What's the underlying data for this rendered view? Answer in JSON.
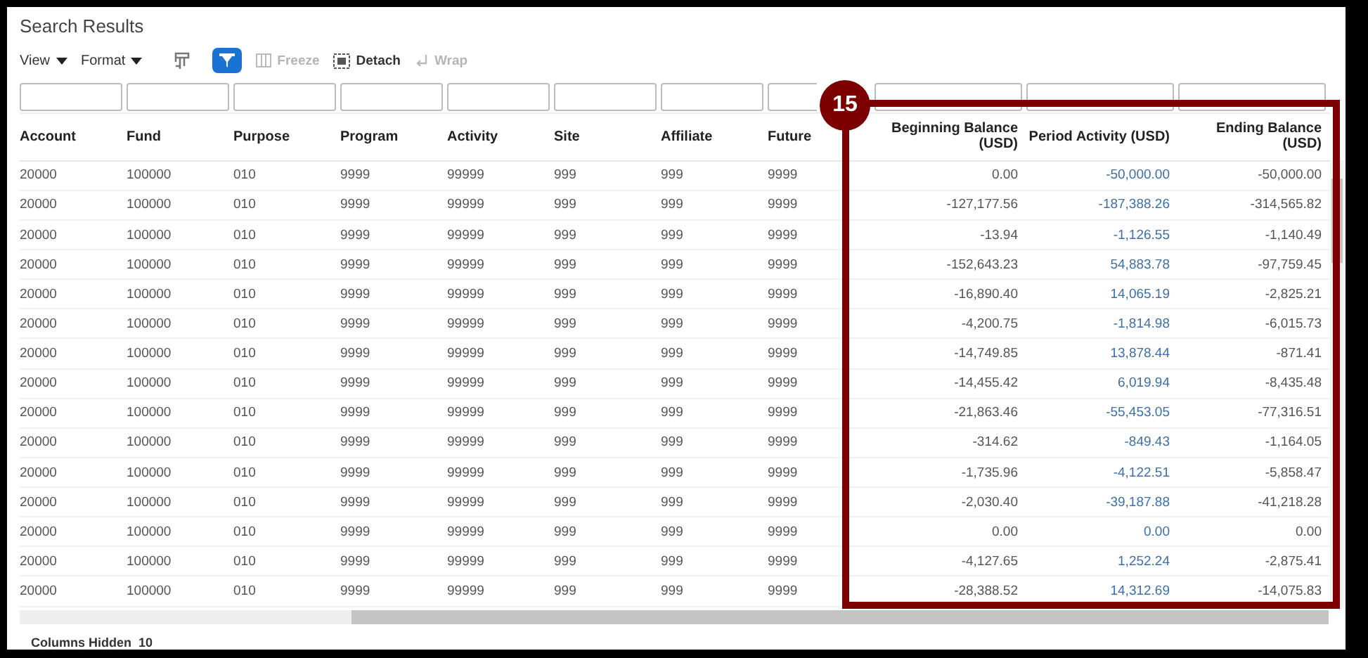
{
  "title": "Search Results",
  "toolbar": {
    "view_menu": {
      "label": "View"
    },
    "format_menu": {
      "label": "Format"
    },
    "query_button": {
      "disabled": false
    },
    "filter_toggle": {
      "selected": true
    },
    "buttons": [
      {
        "kind": "freeze",
        "label": "Freeze",
        "disabled": true
      },
      {
        "kind": "detach",
        "label": "Detach",
        "disabled": false
      },
      {
        "kind": "wrap",
        "label": "Wrap",
        "disabled": true
      }
    ]
  },
  "columns": [
    {
      "label": "Account",
      "kind": "text"
    },
    {
      "label": "Fund",
      "kind": "text"
    },
    {
      "label": "Purpose",
      "kind": "text"
    },
    {
      "label": "Program",
      "kind": "text"
    },
    {
      "label": "Activity",
      "kind": "text"
    },
    {
      "label": "Site",
      "kind": "text"
    },
    {
      "label": "Affiliate",
      "kind": "text"
    },
    {
      "label": "Future",
      "kind": "text"
    },
    {
      "label": "Beginning Balance (USD)",
      "kind": "amount"
    },
    {
      "label": "Period Activity (USD)",
      "kind": "link"
    },
    {
      "label": "Ending Balance (USD)",
      "kind": "amount"
    }
  ],
  "rows": [
    [
      "20000",
      "100000",
      "010",
      "9999",
      "99999",
      "999",
      "999",
      "9999",
      "0.00",
      "-50,000.00",
      "-50,000.00"
    ],
    [
      "20000",
      "100000",
      "010",
      "9999",
      "99999",
      "999",
      "999",
      "9999",
      "-127,177.56",
      "-187,388.26",
      "-314,565.82"
    ],
    [
      "20000",
      "100000",
      "010",
      "9999",
      "99999",
      "999",
      "999",
      "9999",
      "-13.94",
      "-1,126.55",
      "-1,140.49"
    ],
    [
      "20000",
      "100000",
      "010",
      "9999",
      "99999",
      "999",
      "999",
      "9999",
      "-152,643.23",
      "54,883.78",
      "-97,759.45"
    ],
    [
      "20000",
      "100000",
      "010",
      "9999",
      "99999",
      "999",
      "999",
      "9999",
      "-16,890.40",
      "14,065.19",
      "-2,825.21"
    ],
    [
      "20000",
      "100000",
      "010",
      "9999",
      "99999",
      "999",
      "999",
      "9999",
      "-4,200.75",
      "-1,814.98",
      "-6,015.73"
    ],
    [
      "20000",
      "100000",
      "010",
      "9999",
      "99999",
      "999",
      "999",
      "9999",
      "-14,749.85",
      "13,878.44",
      "-871.41"
    ],
    [
      "20000",
      "100000",
      "010",
      "9999",
      "99999",
      "999",
      "999",
      "9999",
      "-14,455.42",
      "6,019.94",
      "-8,435.48"
    ],
    [
      "20000",
      "100000",
      "010",
      "9999",
      "99999",
      "999",
      "999",
      "9999",
      "-21,863.46",
      "-55,453.05",
      "-77,316.51"
    ],
    [
      "20000",
      "100000",
      "010",
      "9999",
      "99999",
      "999",
      "999",
      "9999",
      "-314.62",
      "-849.43",
      "-1,164.05"
    ],
    [
      "20000",
      "100000",
      "010",
      "9999",
      "99999",
      "999",
      "999",
      "9999",
      "-1,735.96",
      "-4,122.51",
      "-5,858.47"
    ],
    [
      "20000",
      "100000",
      "010",
      "9999",
      "99999",
      "999",
      "999",
      "9999",
      "-2,030.40",
      "-39,187.88",
      "-41,218.28"
    ],
    [
      "20000",
      "100000",
      "010",
      "9999",
      "99999",
      "999",
      "999",
      "9999",
      "0.00",
      "0.00",
      "0.00"
    ],
    [
      "20000",
      "100000",
      "010",
      "9999",
      "99999",
      "999",
      "999",
      "9999",
      "-4,127.65",
      "1,252.24",
      "-2,875.41"
    ],
    [
      "20000",
      "100000",
      "010",
      "9999",
      "99999",
      "999",
      "999",
      "9999",
      "-28,388.52",
      "14,312.69",
      "-14,075.83"
    ]
  ],
  "status_bar": {
    "label": "Columns Hidden",
    "value": "10"
  },
  "annotation": {
    "label": "15"
  }
}
